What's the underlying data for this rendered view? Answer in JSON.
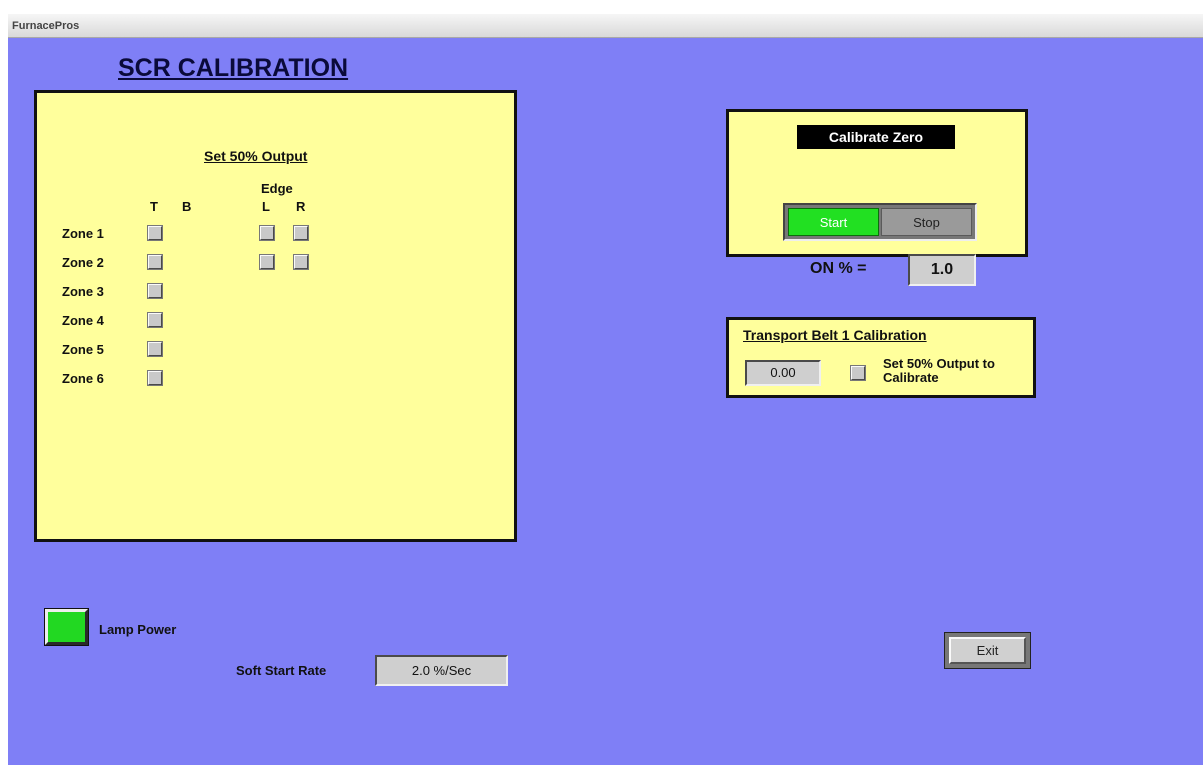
{
  "window": {
    "title": "FurnacePros"
  },
  "page": {
    "title": "SCR CALIBRATION"
  },
  "output_panel": {
    "caption": "Set 50% Output",
    "edge_label": "Edge",
    "columns": {
      "t": "T",
      "b": "B",
      "l": "L",
      "r": "R"
    },
    "zones": [
      {
        "label": "Zone 1",
        "t": false,
        "l": false,
        "r": false
      },
      {
        "label": "Zone 2",
        "t": false,
        "l": false,
        "r": false
      },
      {
        "label": "Zone 3",
        "t": false
      },
      {
        "label": "Zone 4",
        "t": false
      },
      {
        "label": "Zone 5",
        "t": false
      },
      {
        "label": "Zone 6",
        "t": false
      }
    ]
  },
  "calibrate_zero": {
    "caption": "Calibrate Zero",
    "start_label": "Start",
    "stop_label": "Stop",
    "active": "Start",
    "on_label": "ON % =",
    "on_value": "1.0"
  },
  "belt_calibration": {
    "caption": "Transport Belt 1 Calibration",
    "value": "0.00",
    "checkbox_label": "Set 50% Output to Calibrate",
    "checked": false
  },
  "lamp_power": {
    "label": "Lamp Power",
    "on": true
  },
  "soft_start": {
    "label": "Soft Start Rate",
    "value": "2.0 %/Sec"
  },
  "exit_label": "Exit",
  "colors": {
    "workspace": "#7f7ff6",
    "panel": "#ffff9c",
    "active_green": "#22e022",
    "lamp_green": "#22d822"
  }
}
